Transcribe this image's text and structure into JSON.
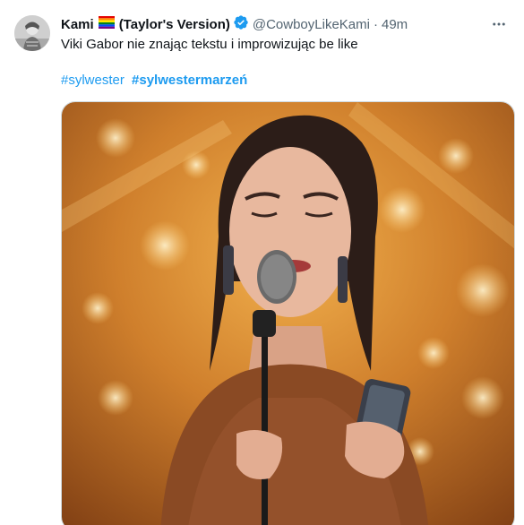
{
  "author": {
    "display_name": "Kami",
    "name_suffix": "(Taylor's Version)",
    "handle": "@CowboyLikeKami",
    "separator": "·",
    "time": "49m",
    "flag_icon": "rainbow-flag-icon",
    "verified_icon": "verified-badge-icon",
    "verified_color": "#1d9bf0"
  },
  "tweet": {
    "text": "Viki Gabor nie znając tekstu i improwizując be like",
    "hashtags": [
      "#sylwester",
      "#sylwestermarzeń"
    ]
  },
  "media": {
    "icon": "photo-icon",
    "accent": "#c98a3a"
  },
  "colors": {
    "text": "#0f1419",
    "secondary": "#536471",
    "link": "#1d9bf0"
  }
}
